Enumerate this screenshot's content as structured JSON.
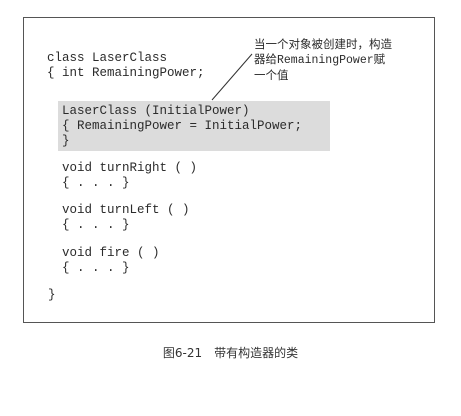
{
  "figure": {
    "class_header": [
      "class LaserClass",
      "{ int RemainingPower;"
    ],
    "constructor": [
      "LaserClass (InitialPower)",
      "{ RemainingPower = InitialPower;",
      "}"
    ],
    "methods": [
      {
        "signature": "void turnRight ( )",
        "body": "{ . . . }"
      },
      {
        "signature": "void turnLeft ( )",
        "body": "{ . . . }"
      },
      {
        "signature": "void fire ( )",
        "body": "{ . . . }"
      }
    ],
    "class_close": "}",
    "annotation": {
      "line1": "当一个对象被创建时，构造",
      "line2_prefix": "器给",
      "line2_code": "RemainingPower",
      "line2_suffix": "赋",
      "line3": "一个值"
    }
  },
  "caption": "图6-21　带有构造器的类"
}
